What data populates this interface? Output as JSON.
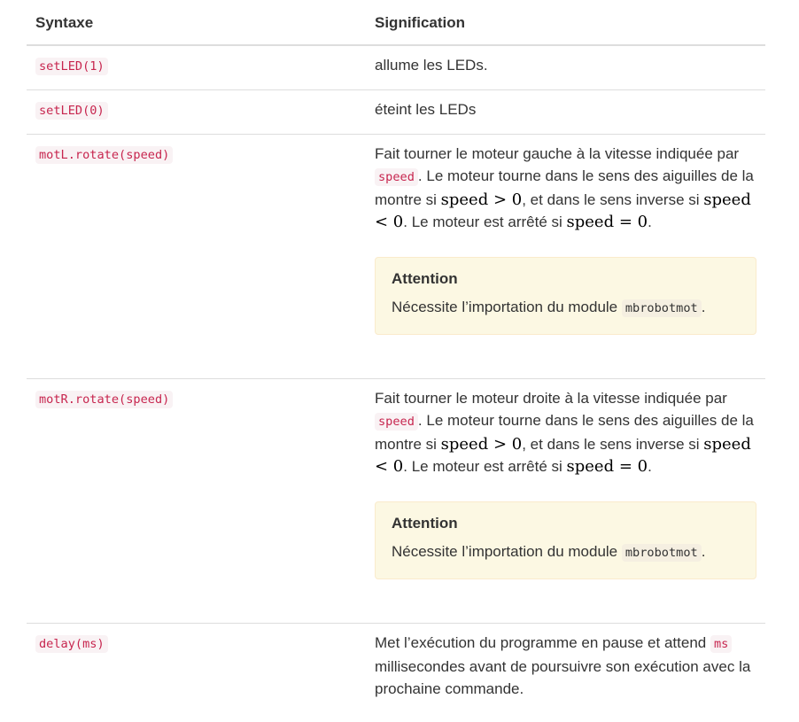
{
  "table": {
    "headers": {
      "syntax": "Syntaxe",
      "meaning": "Signification"
    },
    "rows": [
      {
        "syntax": "setLED(1)",
        "meaning": "allume les LEDs."
      },
      {
        "syntax": "setLED(0)",
        "meaning": "éteint les LEDs"
      },
      {
        "syntax": "motL.rotate(speed)",
        "meaning_p1": "Fait tourner le moteur gauche à la vitesse indiquée par ",
        "meaning_code": "speed",
        "meaning_p2": ". Le moteur tourne dans le sens des aiguilles de la montre si ",
        "math1": "speed > 0",
        "meaning_p3": ", et dans le sens inverse si ",
        "math2": "speed < 0",
        "meaning_p4": ". Le moteur est arrêté si ",
        "math3": "speed = 0",
        "meaning_p5": ".",
        "admonition": {
          "title": "Attention",
          "text": "Nécessite l’importation du module ",
          "code": "mbrobotmot",
          "suffix": "."
        }
      },
      {
        "syntax": "motR.rotate(speed)",
        "meaning_p1": "Fait tourner le moteur droite à la vitesse indiquée par ",
        "meaning_code": "speed",
        "meaning_p2": ". Le moteur tourne dans le sens des aiguilles de la montre si ",
        "math1": "speed > 0",
        "meaning_p3": ", et dans le sens inverse si ",
        "math2": "speed < 0",
        "meaning_p4": ". Le moteur est arrêté si ",
        "math3": "speed = 0",
        "meaning_p5": ".",
        "admonition": {
          "title": "Attention",
          "text": "Nécessite l’importation du module ",
          "code": "mbrobotmot",
          "suffix": "."
        }
      },
      {
        "syntax": "delay(ms)",
        "meaning_p1": "Met l’exécution du programme en pause et attend ",
        "meaning_code": "ms",
        "meaning_p2": " millisecondes avant de poursuivre son exécution avec la prochaine commande."
      }
    ]
  },
  "colors": {
    "text": "#333333",
    "code_text": "#c7254e",
    "code_bg": "#f9f2f4",
    "admonition_bg": "#fcf8e3",
    "admonition_border": "#faebcc",
    "rule": "#dddddd"
  }
}
